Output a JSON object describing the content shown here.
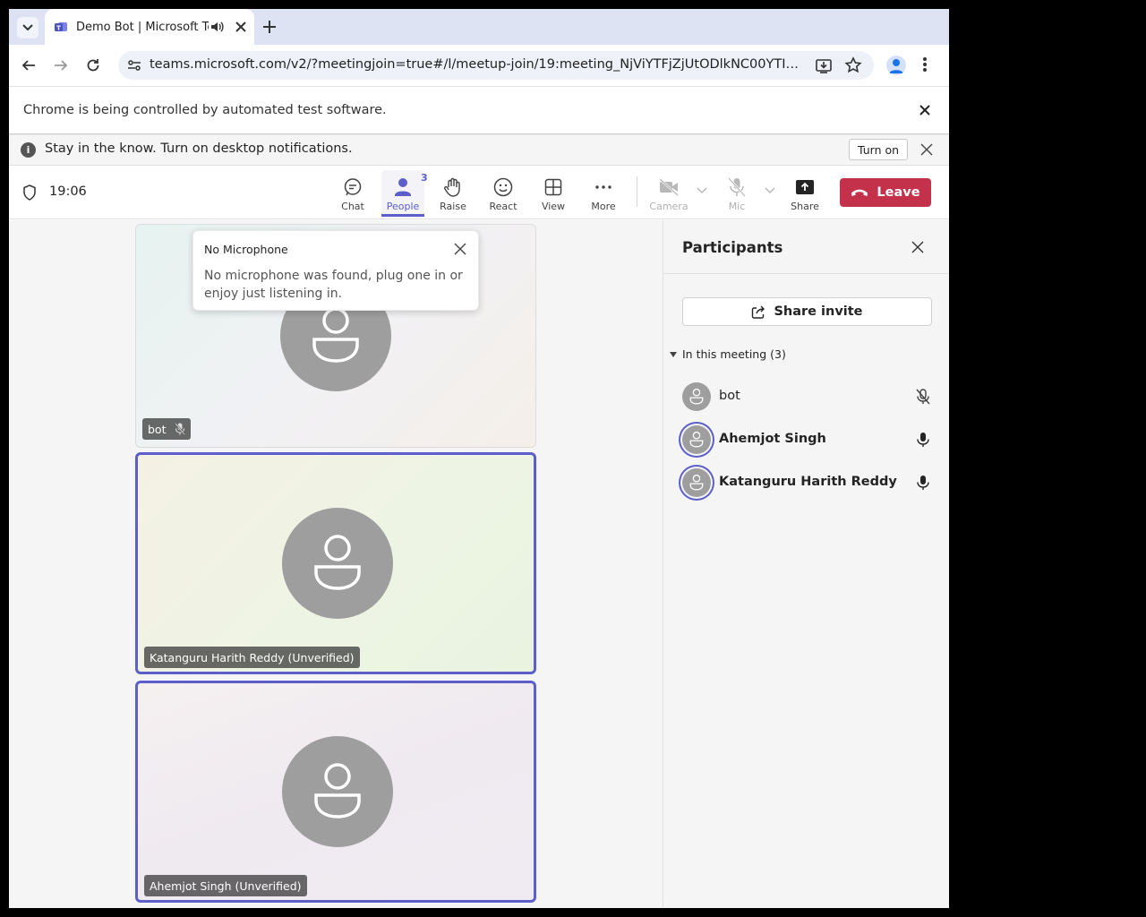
{
  "browser": {
    "tab_title": "Demo Bot | Microsoft Teams",
    "url": "teams.microsoft.com/v2/?meetingjoin=true#/l/meetup-join/19:meeting_NjViYTFjZjUtODlkNC00YTIyL..."
  },
  "automation_bar": {
    "message": "Chrome is being controlled by automated test software."
  },
  "notification_bar": {
    "message": "Stay in the know. Turn on desktop notifications.",
    "turn_on_label": "Turn on"
  },
  "meeting": {
    "timer": "19:06",
    "toolbar": {
      "chat": "Chat",
      "people": "People",
      "people_count": "3",
      "raise": "Raise",
      "react": "React",
      "view": "View",
      "more": "More",
      "camera": "Camera",
      "mic": "Mic",
      "share": "Share",
      "leave": "Leave"
    }
  },
  "popup": {
    "title": "No Microphone",
    "body": "No microphone was found, plug one in or enjoy just listening in."
  },
  "tiles": [
    {
      "name": "bot"
    },
    {
      "name": "Katanguru Harith Reddy (Unverified)"
    },
    {
      "name": "Ahemjot Singh (Unverified)"
    }
  ],
  "participants": {
    "title": "Participants",
    "share_invite": "Share invite",
    "section_label": "In this meeting (3)",
    "people": [
      {
        "name": "bot",
        "mic": "muted"
      },
      {
        "name": "Ahemjot Singh",
        "mic": "on"
      },
      {
        "name": "Katanguru Harith Reddy",
        "mic": "on"
      }
    ]
  },
  "colors": {
    "accent": "#5b5fc7",
    "leave": "#c4314b"
  }
}
